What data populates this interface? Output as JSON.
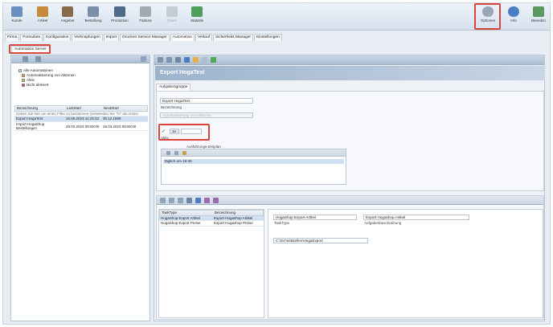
{
  "ribbon": {
    "buttons": [
      {
        "label": "Kunde",
        "icon": "user-icon",
        "color": "#6a8fbf",
        "disabled": false
      },
      {
        "label": "Artikel",
        "icon": "box-icon",
        "color": "#c78b3b",
        "disabled": false
      },
      {
        "label": "Angebot",
        "icon": "handshake-icon",
        "color": "#8a6a4a",
        "disabled": false
      },
      {
        "label": "Bestellung",
        "icon": "document-icon",
        "color": "#7b8fa8",
        "disabled": false
      },
      {
        "label": "Produktion",
        "icon": "production-icon",
        "color": "#4e6b86",
        "disabled": false
      },
      {
        "label": "Faktura",
        "icon": "invoice-icon",
        "color": "#a1a9b3",
        "disabled": false
      },
      {
        "label": "Datev",
        "icon": "datev-icon",
        "color": "#c5ccd4",
        "disabled": true
      },
      {
        "label": "Statistik",
        "icon": "statistics-icon",
        "color": "#4f9e5a",
        "disabled": false
      }
    ],
    "right_buttons": [
      {
        "label": "Optionen",
        "icon": "gear-icon",
        "color": "#9aa6b4"
      },
      {
        "label": "Info",
        "icon": "info-icon",
        "color": "#4a7fc1"
      },
      {
        "label": "Beenden",
        "icon": "exit-icon",
        "color": "#5a9a5e"
      }
    ]
  },
  "tabs": [
    "Firma",
    "Formulare",
    "Konfiguration",
    "Verknüpfungen",
    "Import",
    "Drucken Service Manager",
    "Automation",
    "Verlauf",
    "Sicherheits Manager",
    "Einstellungen"
  ],
  "active_tab": "Automation",
  "subtab": "Automation Server",
  "tree": [
    {
      "label": "Alle Automationen",
      "color": "#d8dde3"
    },
    {
      "label": "Automatisierung von Aktionen",
      "color": "#e39b3c"
    },
    {
      "label": "Aktiv",
      "color": "#e0b040"
    },
    {
      "label": "Nicht aktiviert",
      "color": "#c44"
    }
  ],
  "grid": {
    "headers": [
      "Bezeichnung",
      "LastStart",
      "NextStart"
    ],
    "filter_hint": "Geben Sie hier um einen Filter zu bestimmen (verwenden Sie \"%\" als erstes",
    "rows": [
      {
        "name": "Export HogaTest",
        "last": "16.06.2023 11:15:33",
        "next": "30.12.1899"
      },
      {
        "name": "Import HogaShop Bestellungen",
        "last": "28.03.2023 09:00:00",
        "next": "28.03.2023 09:00:00"
      }
    ]
  },
  "detail": {
    "title": "Export HogaTest",
    "group_tab": "Aufgabengruppe",
    "bezeichnung_value": "Export HogaTest",
    "bezeichnung_label": "Bezeichnung",
    "action_value": "Automatisierung von Aktionen",
    "aktiv_value": "Ja",
    "aktiv_label": "Aktiv",
    "sched_title": "Ausführungs-Zeitplan",
    "sched_item": "täglich um 16:40"
  },
  "tasks": {
    "headers": [
      "TaskType",
      "Bezeichnung"
    ],
    "rows": [
      {
        "type": "HogaShop Export Artikel",
        "name": "Export Hogashop Artikel"
      },
      {
        "type": "HogaShop Export Preise",
        "name": "Export Hogashop Preise"
      }
    ],
    "tasktype_value": "HogaShop Export Artikel",
    "tasktype_label": "TaskType",
    "aufgabe_value": "Export Hogashop Artikel",
    "aufgabe_label": "Aufgabenbeschreibung",
    "path_value": "C:\\Schnittstellen\\HogaExport"
  }
}
